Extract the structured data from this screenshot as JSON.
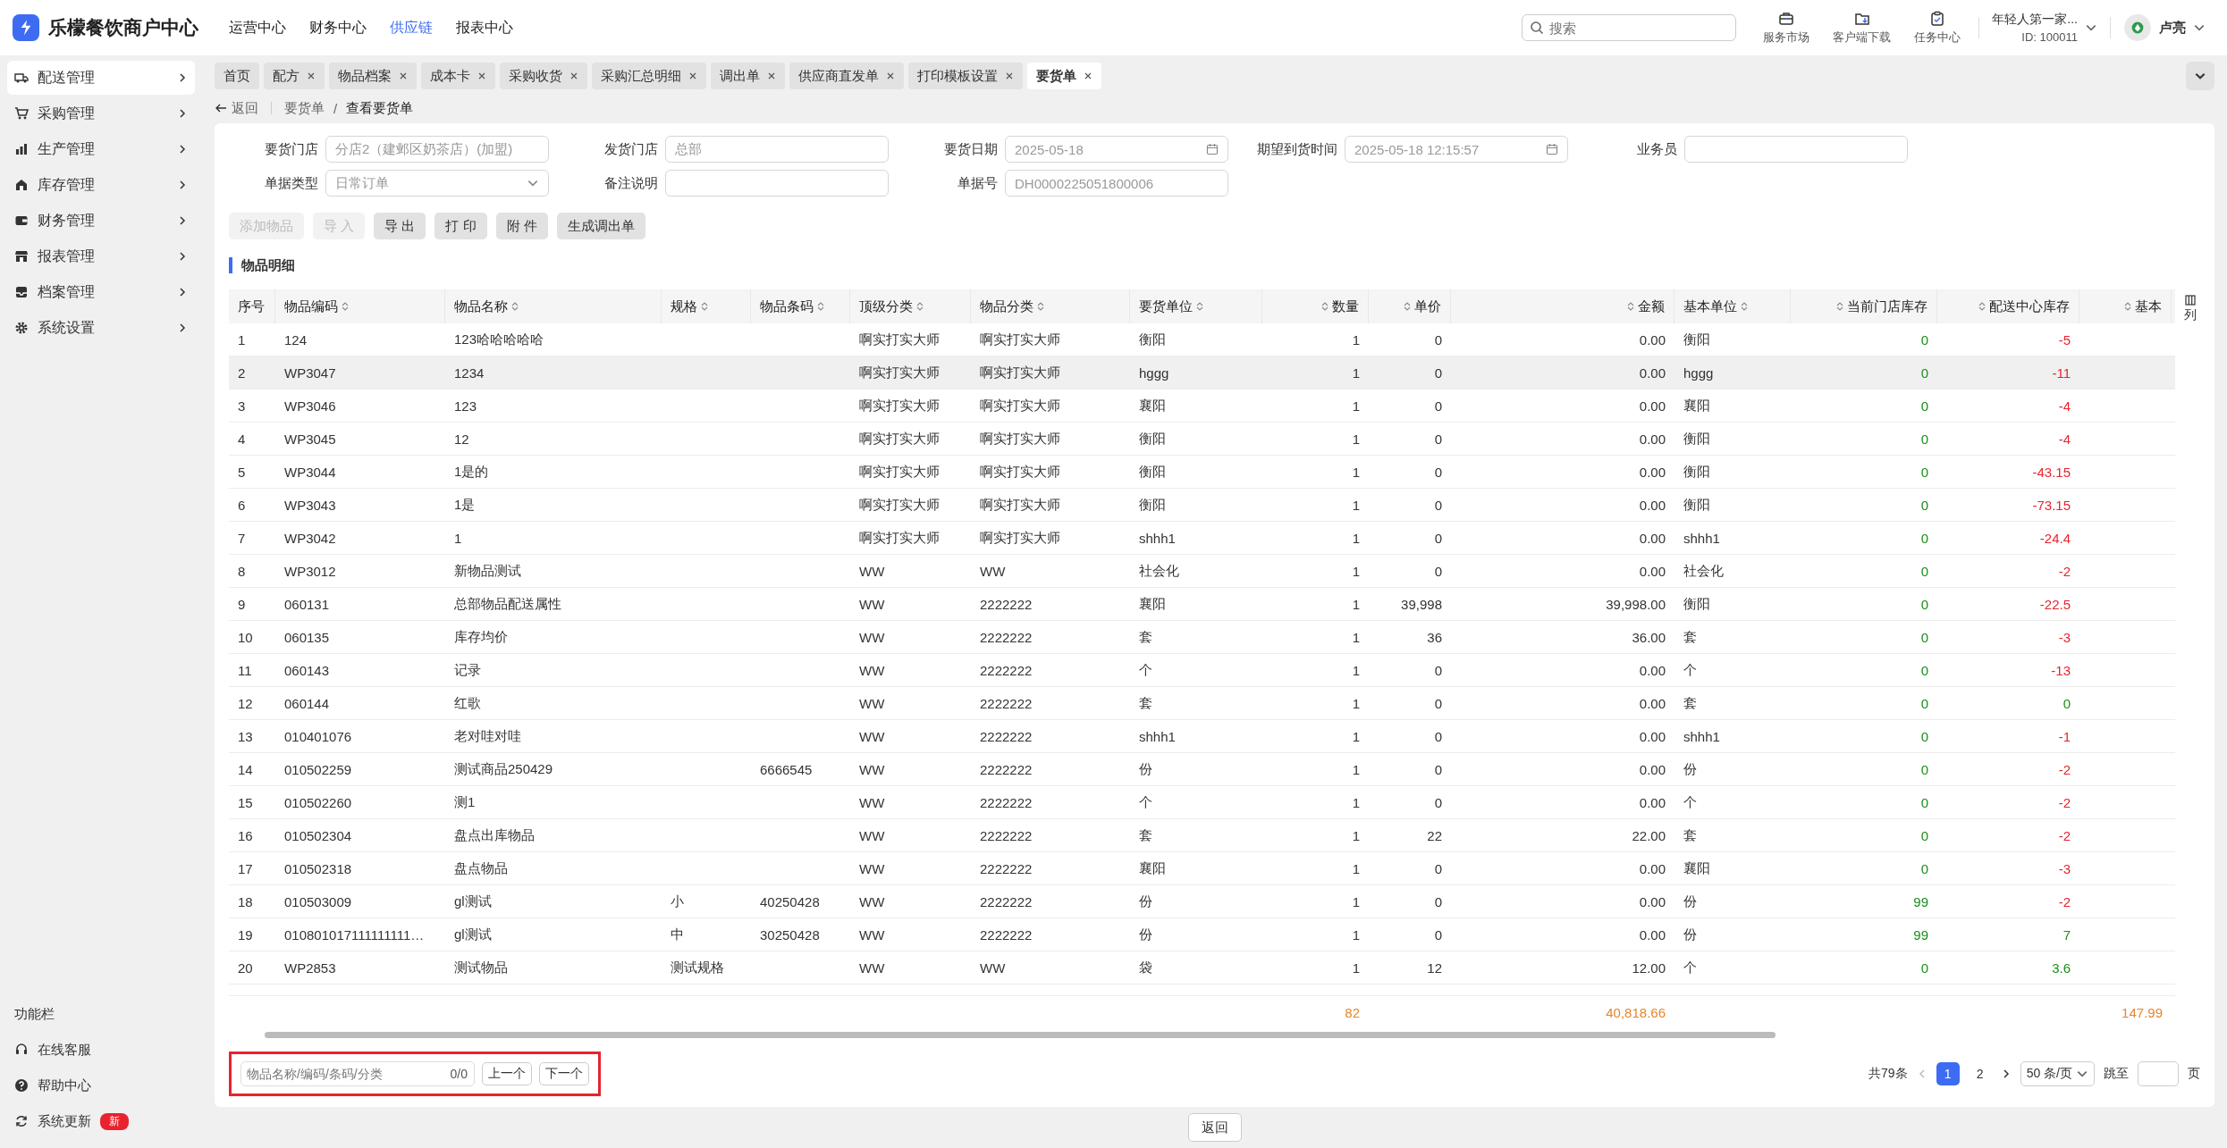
{
  "header": {
    "app_title": "乐檬餐饮商户中心",
    "nav": [
      {
        "label": "运营中心",
        "selected": false
      },
      {
        "label": "财务中心",
        "selected": false
      },
      {
        "label": "供应链",
        "selected": true
      },
      {
        "label": "报表中心",
        "selected": false
      }
    ],
    "search": {
      "placeholder": "搜索"
    },
    "tools": [
      {
        "kind": "market",
        "label": "服务市场"
      },
      {
        "kind": "download",
        "label": "客户端下载"
      },
      {
        "kind": "tasks",
        "label": "任务中心"
      }
    ],
    "account": {
      "name": "年轻人第一家...",
      "id": "ID: 100011"
    },
    "user": {
      "name": "卢亮"
    }
  },
  "sidebar": {
    "items": [
      {
        "kind": "truck",
        "label": "配送管理",
        "selected": true
      },
      {
        "kind": "cart",
        "label": "采购管理",
        "selected": false
      },
      {
        "kind": "chart",
        "label": "生产管理",
        "selected": false
      },
      {
        "kind": "store",
        "label": "库存管理",
        "selected": false
      },
      {
        "kind": "wallet",
        "label": "财务管理",
        "selected": false
      },
      {
        "kind": "shop",
        "label": "报表管理",
        "selected": false
      },
      {
        "kind": "inbox",
        "label": "档案管理",
        "selected": false
      },
      {
        "kind": "gear",
        "label": "系统设置",
        "selected": false
      }
    ],
    "function_bar": {
      "title": "功能栏",
      "items": [
        {
          "kind": "service",
          "label": "在线客服"
        },
        {
          "kind": "help",
          "label": "帮助中心"
        },
        {
          "kind": "update",
          "label": "系统更新",
          "badge": "新"
        }
      ]
    }
  },
  "tabs": [
    {
      "label": "首页",
      "closable": false,
      "selected": false
    },
    {
      "label": "配方",
      "closable": true,
      "selected": false
    },
    {
      "label": "物品档案",
      "closable": true,
      "selected": false
    },
    {
      "label": "成本卡",
      "closable": true,
      "selected": false
    },
    {
      "label": "采购收货",
      "closable": true,
      "selected": false
    },
    {
      "label": "采购汇总明细",
      "closable": true,
      "selected": false
    },
    {
      "label": "调出单",
      "closable": true,
      "selected": false
    },
    {
      "label": "供应商直发单",
      "closable": true,
      "selected": false
    },
    {
      "label": "打印模板设置",
      "closable": true,
      "selected": false
    },
    {
      "label": "要货单",
      "closable": true,
      "selected": true
    }
  ],
  "breadcrumb": {
    "back": "返回",
    "separator": "/",
    "items": [
      "要货单",
      "查看要货单"
    ]
  },
  "form": {
    "rows": [
      [
        {
          "label": "要货门店",
          "kind": "text",
          "value": "分店2（建邺区奶茶店）(加盟)"
        },
        {
          "label": "发货门店",
          "kind": "text",
          "value": "总部"
        },
        {
          "label": "要货日期",
          "kind": "date",
          "value": "2025-05-18"
        },
        {
          "label": "期望到货时间",
          "kind": "date",
          "value": "2025-05-18 12:15:57"
        },
        {
          "label": "业务员",
          "kind": "text"
        }
      ],
      [
        {
          "label": "单据类型",
          "kind": "select",
          "value": "日常订单"
        },
        {
          "label": "备注说明",
          "kind": "text"
        },
        {
          "label": "单据号",
          "kind": "text",
          "value": "DH0000225051800006"
        }
      ]
    ]
  },
  "actions": [
    {
      "label": "添加物品",
      "disabled": true
    },
    {
      "label": "导 入",
      "disabled": true
    },
    {
      "label": "导 出",
      "disabled": false
    },
    {
      "label": "打 印",
      "disabled": false
    },
    {
      "label": "附 件",
      "disabled": false
    },
    {
      "label": "生成调出单",
      "disabled": false
    }
  ],
  "section_title": "物品明细",
  "table": {
    "columns": [
      "序号",
      "物品编码",
      "物品名称",
      "规格",
      "物品条码",
      "顶级分类",
      "物品分类",
      "要货单位",
      "数量",
      "单价",
      "金额",
      "基本单位",
      "当前门店库存",
      "配送中心库存",
      "基本"
    ],
    "column_settings": "列",
    "rows": [
      {
        "seq": "1",
        "code": "124",
        "name": "123哈哈哈哈哈",
        "spec": "",
        "barcode": "",
        "top_category": "啊实打实大师",
        "category": "啊实打实大师",
        "unit": "衡阳",
        "quantity": "1",
        "price": "0",
        "amount": "0.00",
        "base_unit": "衡阳",
        "store_stock": "0",
        "center_stock": "-5",
        "center_negative": true,
        "selected": false
      },
      {
        "seq": "2",
        "code": "WP3047",
        "name": "1234",
        "spec": "",
        "barcode": "",
        "top_category": "啊实打实大师",
        "category": "啊实打实大师",
        "unit": "hggg",
        "quantity": "1",
        "price": "0",
        "amount": "0.00",
        "base_unit": "hggg",
        "store_stock": "0",
        "center_stock": "-11",
        "center_negative": true,
        "selected": true
      },
      {
        "seq": "3",
        "code": "WP3046",
        "name": "123",
        "spec": "",
        "barcode": "",
        "top_category": "啊实打实大师",
        "category": "啊实打实大师",
        "unit": "襄阳",
        "quantity": "1",
        "price": "0",
        "amount": "0.00",
        "base_unit": "襄阳",
        "store_stock": "0",
        "center_stock": "-4",
        "center_negative": true,
        "selected": false
      },
      {
        "seq": "4",
        "code": "WP3045",
        "name": "12",
        "spec": "",
        "barcode": "",
        "top_category": "啊实打实大师",
        "category": "啊实打实大师",
        "unit": "衡阳",
        "quantity": "1",
        "price": "0",
        "amount": "0.00",
        "base_unit": "衡阳",
        "store_stock": "0",
        "center_stock": "-4",
        "center_negative": true,
        "selected": false
      },
      {
        "seq": "5",
        "code": "WP3044",
        "name": "1是的",
        "spec": "",
        "barcode": "",
        "top_category": "啊实打实大师",
        "category": "啊实打实大师",
        "unit": "衡阳",
        "quantity": "1",
        "price": "0",
        "amount": "0.00",
        "base_unit": "衡阳",
        "store_stock": "0",
        "center_stock": "-43.15",
        "center_negative": true,
        "selected": false
      },
      {
        "seq": "6",
        "code": "WP3043",
        "name": "1是",
        "spec": "",
        "barcode": "",
        "top_category": "啊实打实大师",
        "category": "啊实打实大师",
        "unit": "衡阳",
        "quantity": "1",
        "price": "0",
        "amount": "0.00",
        "base_unit": "衡阳",
        "store_stock": "0",
        "center_stock": "-73.15",
        "center_negative": true,
        "selected": false
      },
      {
        "seq": "7",
        "code": "WP3042",
        "name": "1",
        "spec": "",
        "barcode": "",
        "top_category": "啊实打实大师",
        "category": "啊实打实大师",
        "unit": "shhh1",
        "quantity": "1",
        "price": "0",
        "amount": "0.00",
        "base_unit": "shhh1",
        "store_stock": "0",
        "center_stock": "-24.4",
        "center_negative": true,
        "selected": false
      },
      {
        "seq": "8",
        "code": "WP3012",
        "name": "新物品测试",
        "spec": "",
        "barcode": "",
        "top_category": "WW",
        "category": "WW",
        "unit": "社会化",
        "quantity": "1",
        "price": "0",
        "amount": "0.00",
        "base_unit": "社会化",
        "store_stock": "0",
        "center_stock": "-2",
        "center_negative": true,
        "selected": false
      },
      {
        "seq": "9",
        "code": "060131",
        "name": "总部物品配送属性",
        "spec": "",
        "barcode": "",
        "top_category": "WW",
        "category": "2222222",
        "unit": "襄阳",
        "quantity": "1",
        "price": "39,998",
        "amount": "39,998.00",
        "base_unit": "衡阳",
        "store_stock": "0",
        "center_stock": "-22.5",
        "center_negative": true,
        "selected": false
      },
      {
        "seq": "10",
        "code": "060135",
        "name": "库存均价",
        "spec": "",
        "barcode": "",
        "top_category": "WW",
        "category": "2222222",
        "unit": "套",
        "quantity": "1",
        "price": "36",
        "amount": "36.00",
        "base_unit": "套",
        "store_stock": "0",
        "center_stock": "-3",
        "center_negative": true,
        "selected": false
      },
      {
        "seq": "11",
        "code": "060143",
        "name": "记录",
        "spec": "",
        "barcode": "",
        "top_category": "WW",
        "category": "2222222",
        "unit": "个",
        "quantity": "1",
        "price": "0",
        "amount": "0.00",
        "base_unit": "个",
        "store_stock": "0",
        "center_stock": "-13",
        "center_negative": true,
        "selected": false
      },
      {
        "seq": "12",
        "code": "060144",
        "name": "红歌",
        "spec": "",
        "barcode": "",
        "top_category": "WW",
        "category": "2222222",
        "unit": "套",
        "quantity": "1",
        "price": "0",
        "amount": "0.00",
        "base_unit": "套",
        "store_stock": "0",
        "center_stock": "0",
        "center_negative": false,
        "selected": false
      },
      {
        "seq": "13",
        "code": "010401076",
        "name": "老对哇对哇",
        "spec": "",
        "barcode": "",
        "top_category": "WW",
        "category": "2222222",
        "unit": "shhh1",
        "quantity": "1",
        "price": "0",
        "amount": "0.00",
        "base_unit": "shhh1",
        "store_stock": "0",
        "center_stock": "-1",
        "center_negative": true,
        "selected": false
      },
      {
        "seq": "14",
        "code": "010502259",
        "name": "测试商品250429",
        "spec": "",
        "barcode": "6666545",
        "top_category": "WW",
        "category": "2222222",
        "unit": "份",
        "quantity": "1",
        "price": "0",
        "amount": "0.00",
        "base_unit": "份",
        "store_stock": "0",
        "center_stock": "-2",
        "center_negative": true,
        "selected": false
      },
      {
        "seq": "15",
        "code": "010502260",
        "name": "测1",
        "spec": "",
        "barcode": "",
        "top_category": "WW",
        "category": "2222222",
        "unit": "个",
        "quantity": "1",
        "price": "0",
        "amount": "0.00",
        "base_unit": "个",
        "store_stock": "0",
        "center_stock": "-2",
        "center_negative": true,
        "selected": false
      },
      {
        "seq": "16",
        "code": "010502304",
        "name": "盘点出库物品",
        "spec": "",
        "barcode": "",
        "top_category": "WW",
        "category": "2222222",
        "unit": "套",
        "quantity": "1",
        "price": "22",
        "amount": "22.00",
        "base_unit": "套",
        "store_stock": "0",
        "center_stock": "-2",
        "center_negative": true,
        "selected": false
      },
      {
        "seq": "17",
        "code": "010502318",
        "name": "盘点物品",
        "spec": "",
        "barcode": "",
        "top_category": "WW",
        "category": "2222222",
        "unit": "襄阳",
        "quantity": "1",
        "price": "0",
        "amount": "0.00",
        "base_unit": "襄阳",
        "store_stock": "0",
        "center_stock": "-3",
        "center_negative": true,
        "selected": false
      },
      {
        "seq": "18",
        "code": "010503009",
        "name": "gl测试",
        "spec": "小",
        "barcode": "40250428",
        "top_category": "WW",
        "category": "2222222",
        "unit": "份",
        "quantity": "1",
        "price": "0",
        "amount": "0.00",
        "base_unit": "份",
        "store_stock": "99",
        "center_stock": "-2",
        "center_negative": true,
        "selected": false
      },
      {
        "seq": "19",
        "code": "010801017111111111…",
        "name": "gl测试",
        "spec": "中",
        "barcode": "30250428",
        "top_category": "WW",
        "category": "2222222",
        "unit": "份",
        "quantity": "1",
        "price": "0",
        "amount": "0.00",
        "base_unit": "份",
        "store_stock": "99",
        "center_stock": "7",
        "center_negative": false,
        "selected": false
      },
      {
        "seq": "20",
        "code": "WP2853",
        "name": "测试物品",
        "spec": "测试规格",
        "barcode": "",
        "top_category": "WW",
        "category": "WW",
        "unit": "袋",
        "quantity": "1",
        "price": "12",
        "amount": "12.00",
        "base_unit": "个",
        "store_stock": "0",
        "center_stock": "3.6",
        "center_negative": false,
        "selected": false
      }
    ],
    "totals": {
      "quantity": "82",
      "amount": "40,818.66",
      "column_15": "147.99"
    }
  },
  "finder": {
    "placeholder": "物品名称/编码/条码/分类",
    "count": "0/0",
    "prev": "上一个",
    "next": "下一个"
  },
  "pagination": {
    "total": "共79条",
    "pages": [
      {
        "label": "1",
        "selected": true
      },
      {
        "label": "2",
        "selected": false
      }
    ],
    "page_size": "50 条/页",
    "jump_label": "跳至",
    "page_unit": "页"
  },
  "footer_button": "返回"
}
